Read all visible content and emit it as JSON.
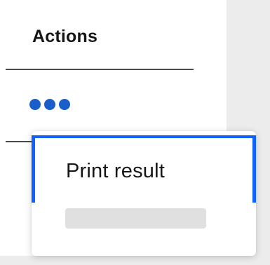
{
  "table": {
    "column_header": "Actions"
  },
  "row": {
    "overflow_menu_icon": "overflow-menu-horizontal-icon"
  },
  "menu": {
    "items": [
      {
        "label": "Print result"
      }
    ],
    "loading_placeholder": ""
  },
  "colors": {
    "accent": "#0f62fe",
    "overflow_dots": "#1a5fc9",
    "skeleton": "#e0e0e0",
    "text": "#161616"
  }
}
